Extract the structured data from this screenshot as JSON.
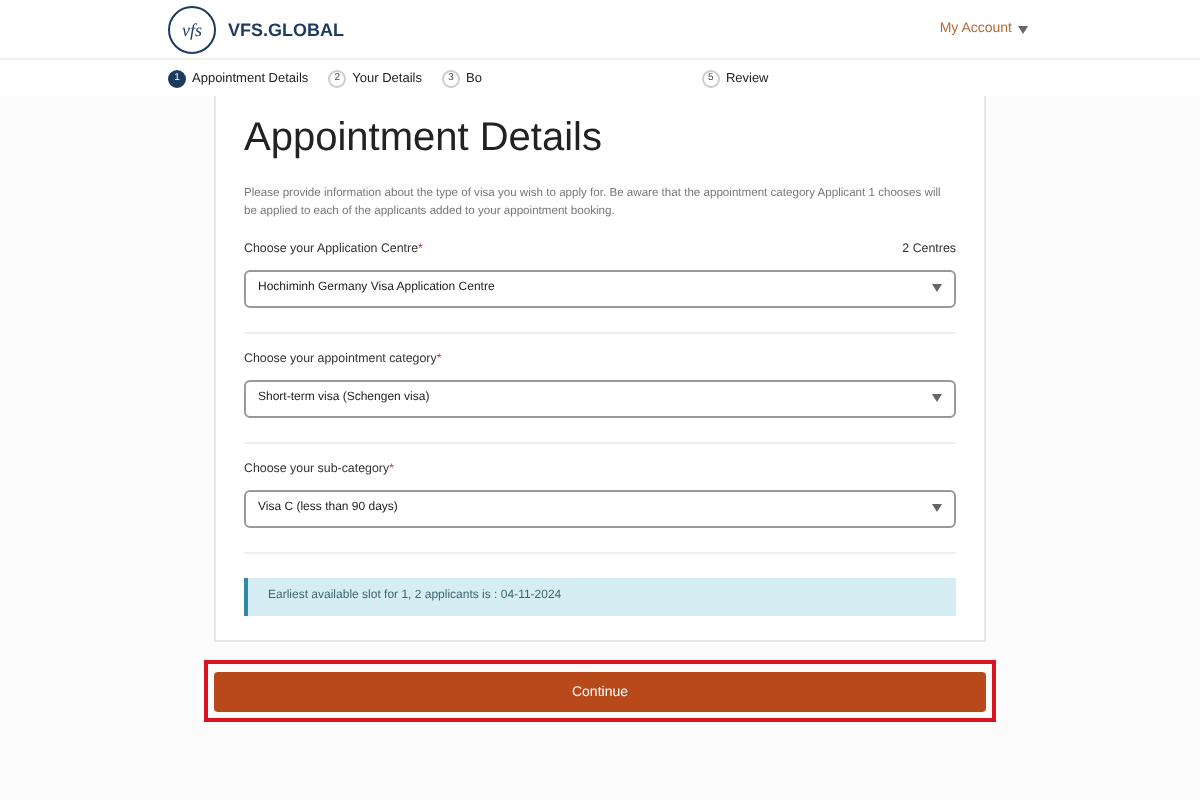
{
  "header": {
    "brand": "VFS.GLOBAL",
    "logo_mark": "vfs",
    "account": "My Account"
  },
  "steps": [
    {
      "number": "1",
      "label": "Appointment Details",
      "selected": true
    },
    {
      "number": "2",
      "label": "Your Details",
      "selected": false
    },
    {
      "number": "3",
      "label": "Bo",
      "selected": false
    },
    {
      "number": "5",
      "label": "Review",
      "selected": false
    }
  ],
  "card": {
    "title": "Appointment Details",
    "intro": "Please provide information about the type of visa you wish to apply for. Be aware that the appointment category Applicant 1 chooses will be applied to each of the applicants added to your appointment booking.",
    "fields": [
      {
        "label": "Choose your Application Centre",
        "required_mark": "*",
        "note": "2 Centres",
        "value": "Hochiminh Germany Visa Application Centre"
      },
      {
        "label": "Choose your appointment category",
        "required_mark": "*",
        "value": "Short-term visa (Schengen visa)"
      },
      {
        "label": "Choose your sub-category",
        "required_mark": "*",
        "value": "Visa C (less than 90 days)"
      }
    ],
    "alert": "Earliest available slot for 1, 2 applicants is : 04-11-2024"
  },
  "continue_button": {
    "label": "Continue",
    "highlighted": true
  }
}
